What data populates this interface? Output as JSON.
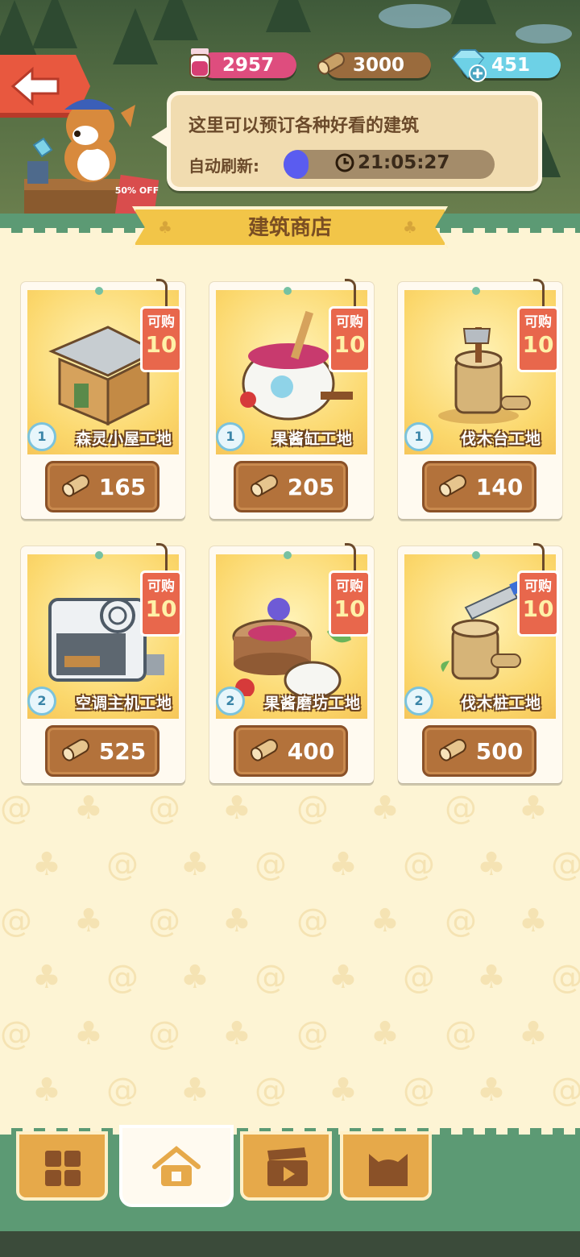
{
  "currencies": {
    "jam": "2957",
    "wood": "3000",
    "gems": "451"
  },
  "bubble": {
    "text": "这里可以预订各种好看的建筑",
    "refresh_label": "自动刷新:",
    "timer": "21:05:27",
    "timer_progress": 0.12
  },
  "sale_sign": "50% OFF",
  "shop_title": "建筑商店",
  "tag_label": "可购",
  "items": [
    {
      "name": "森灵小屋工地",
      "level": "1",
      "count": "10",
      "price": "165"
    },
    {
      "name": "果酱缸工地",
      "level": "1",
      "count": "10",
      "price": "205"
    },
    {
      "name": "伐木台工地",
      "level": "1",
      "count": "10",
      "price": "140"
    },
    {
      "name": "空调主机工地",
      "level": "2",
      "count": "10",
      "price": "525"
    },
    {
      "name": "果酱磨坊工地",
      "level": "2",
      "count": "10",
      "price": "400"
    },
    {
      "name": "伐木桩工地",
      "level": "2",
      "count": "10",
      "price": "500"
    }
  ],
  "nav": {
    "tabs": [
      "grid-icon",
      "home-icon",
      "clapper-icon",
      "cat-icon"
    ],
    "active": "home-icon"
  },
  "colors": {
    "accent_green": "#5c9a74",
    "jam": "#de4d7e",
    "wood": "#9a6b3d",
    "gem": "#6dd1e6",
    "tag": "#e8674c"
  }
}
